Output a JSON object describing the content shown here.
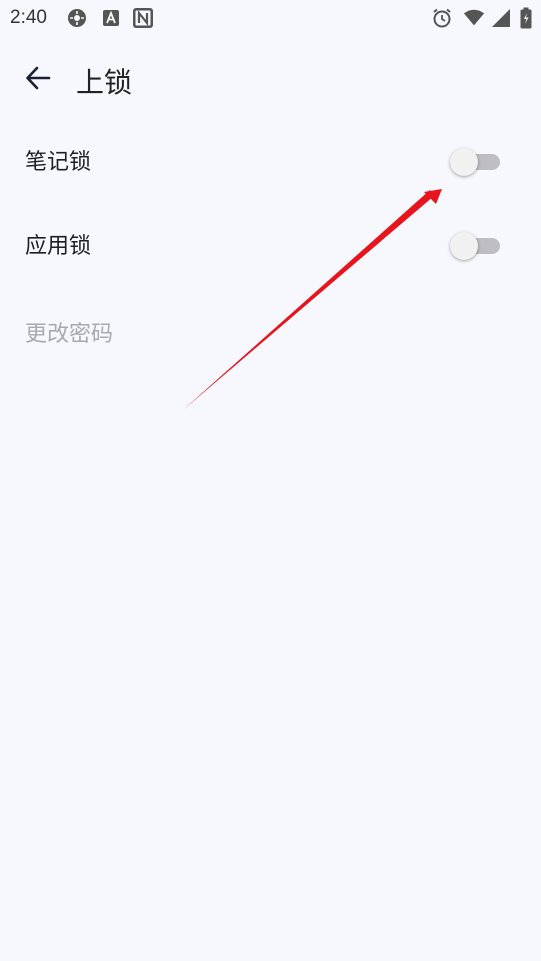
{
  "status_bar": {
    "time": "2:40",
    "icons": [
      "settings-gear-icon",
      "app-a-icon",
      "notion-n-icon",
      "alarm-icon",
      "wifi-icon",
      "cellular-signal-icon",
      "battery-icon"
    ]
  },
  "toolbar": {
    "back_icon": "arrow-left-icon",
    "title": "上锁"
  },
  "settings": {
    "note_lock": {
      "label": "笔记锁",
      "enabled": false
    },
    "app_lock": {
      "label": "应用锁",
      "enabled": false
    },
    "change_password": {
      "label": "更改密码",
      "enabled": false
    }
  },
  "colors": {
    "background": "#f7f8fd",
    "switch_track_off": "#bdbdc2",
    "switch_thumb_off": "#f1f1f1",
    "disabled_text": "#a9a9ad",
    "annotation_arrow": "#e8141c"
  }
}
